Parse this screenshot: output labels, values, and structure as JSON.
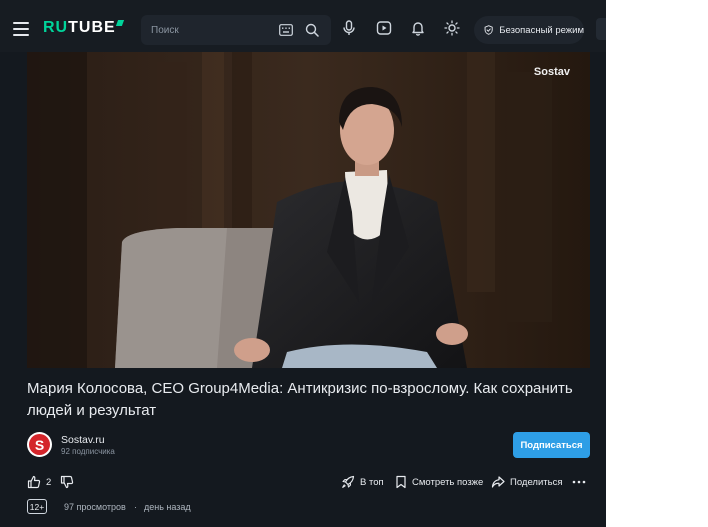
{
  "header": {
    "logo": "RUTUBE",
    "search_placeholder": "Поиск",
    "safe_mode_label": "Безопасный режим",
    "icons": [
      "menu-icon",
      "keyboard-icon",
      "search-icon",
      "microphone-icon",
      "upload-icon",
      "bell-icon",
      "sun-icon",
      "shield-icon"
    ]
  },
  "player": {
    "watermark": "Sostav"
  },
  "video": {
    "title": "Мария Колосова, CEO Group4Media: Антикризис по-взрослому. Как сохранить людей и результат",
    "channel": {
      "name": "Sostav.ru",
      "subscribers": "92 подписчика",
      "avatar_letter": "S"
    },
    "subscribe_label": "Подписаться",
    "likes": "2",
    "actions": {
      "top": "В топ",
      "watch_later": "Смотреть позже",
      "share": "Поделиться"
    },
    "age_rating": "12+",
    "views": "97 просмотров",
    "separator": "·",
    "published": "день назад"
  },
  "colors": {
    "background": "#14191f",
    "header": "#171c22",
    "accent_green": "#00d39a",
    "subscribe_blue": "#2e9ee6",
    "avatar_red": "#d4252b"
  }
}
